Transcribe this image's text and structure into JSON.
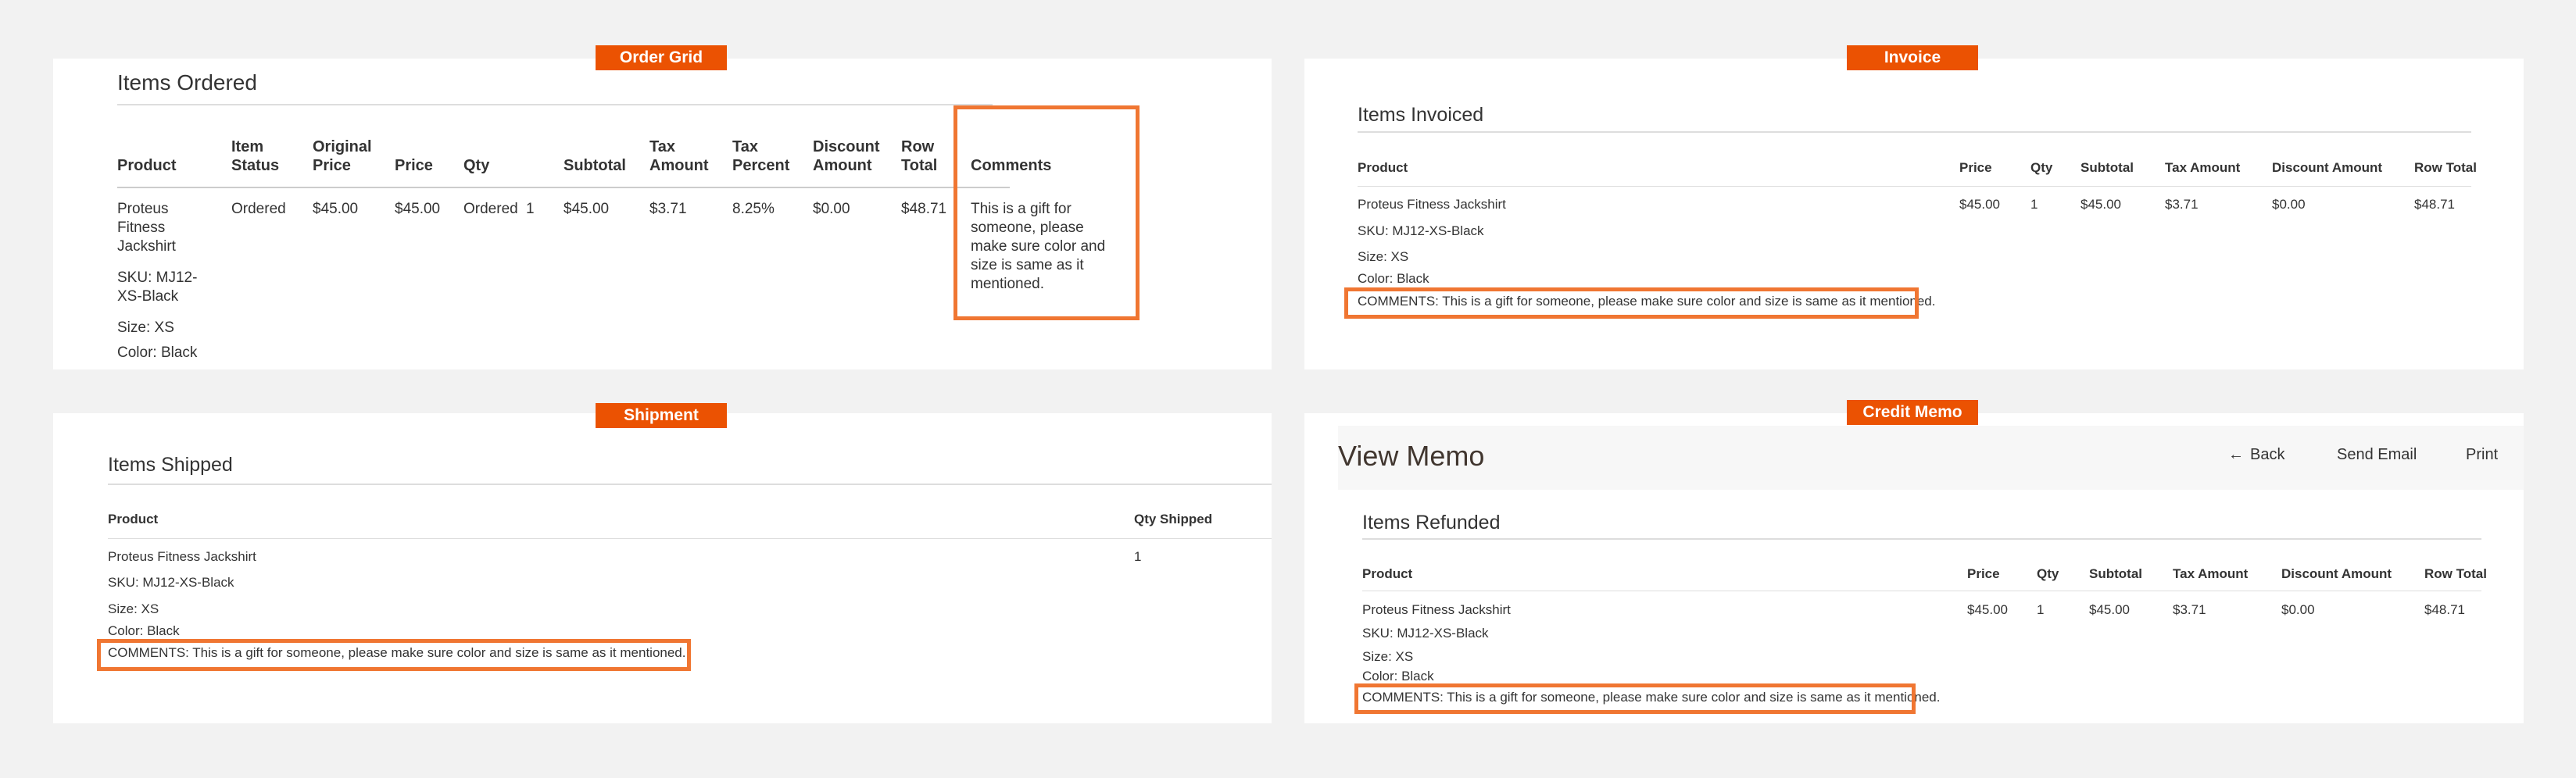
{
  "badges": {
    "order_grid": "Order Grid",
    "invoice": "Invoice",
    "shipment": "Shipment",
    "credit_memo": "Credit Memo"
  },
  "order_grid": {
    "title": "Items Ordered",
    "headers": {
      "product": "Product",
      "item_status_1": "Item",
      "item_status_2": "Status",
      "original_price_1": "Original",
      "original_price_2": "Price",
      "price": "Price",
      "qty": "Qty",
      "subtotal": "Subtotal",
      "tax_amount_1": "Tax",
      "tax_amount_2": "Amount",
      "tax_percent_1": "Tax",
      "tax_percent_2": "Percent",
      "discount_amount_1": "Discount",
      "discount_amount_2": "Amount",
      "row_total_1": "Row",
      "row_total_2": "Total",
      "comments": "Comments"
    },
    "row": {
      "product_line1": "Proteus",
      "product_line2": "Fitness",
      "product_line3": "Jackshirt",
      "sku_line1": "SKU: MJ12-",
      "sku_line2": "XS-Black",
      "size": "Size: XS",
      "color": "Color: Black",
      "status": "Ordered",
      "original_price": "$45.00",
      "price": "$45.00",
      "qty_label": "Ordered",
      "qty_value": "1",
      "subtotal": "$45.00",
      "tax_amount": "$3.71",
      "tax_percent": "8.25%",
      "discount_amount": "$0.00",
      "row_total": "$48.71",
      "comment_lines": [
        "This is a gift for",
        "someone, please",
        "make sure color and",
        "size is same as it",
        "mentioned."
      ]
    }
  },
  "invoice": {
    "title": "Items Invoiced",
    "headers": {
      "product": "Product",
      "price": "Price",
      "qty": "Qty",
      "subtotal": "Subtotal",
      "tax_amount": "Tax Amount",
      "discount_amount": "Discount Amount",
      "row_total": "Row Total"
    },
    "row": {
      "product": "Proteus Fitness Jackshirt",
      "sku": "SKU: MJ12-XS-Black",
      "size": "Size: XS",
      "color": "Color: Black",
      "comments": "COMMENTS: This is a gift for someone, please make sure color and size is same as it mentioned.",
      "price": "$45.00",
      "qty": "1",
      "subtotal": "$45.00",
      "tax_amount": "$3.71",
      "discount_amount": "$0.00",
      "row_total": "$48.71"
    }
  },
  "shipment": {
    "title": "Items Shipped",
    "headers": {
      "product": "Product",
      "qty_shipped": "Qty Shipped"
    },
    "row": {
      "product": "Proteus Fitness Jackshirt",
      "sku": "SKU: MJ12-XS-Black",
      "size": "Size: XS",
      "color": "Color: Black",
      "comments": "COMMENTS: This is a gift for someone, please make sure color and size is same as it mentioned.",
      "qty_shipped": "1"
    }
  },
  "credit_memo": {
    "page_title": "View Memo",
    "actions": {
      "back": "Back",
      "send_email": "Send Email",
      "print": "Print"
    },
    "title": "Items Refunded",
    "headers": {
      "product": "Product",
      "price": "Price",
      "qty": "Qty",
      "subtotal": "Subtotal",
      "tax_amount": "Tax Amount",
      "discount_amount": "Discount Amount",
      "row_total": "Row Total"
    },
    "row": {
      "product": "Proteus Fitness Jackshirt",
      "sku": "SKU: MJ12-XS-Black",
      "size": "Size: XS",
      "color": "Color: Black",
      "comments": "COMMENTS: This is a gift for someone, please make sure color and size is same as it mentioned.",
      "price": "$45.00",
      "qty": "1",
      "subtotal": "$45.00",
      "tax_amount": "$3.71",
      "discount_amount": "$0.00",
      "row_total": "$48.71"
    }
  },
  "colors": {
    "badge": "#eb5202",
    "highlight": "#f07632",
    "background": "#f2f2f2"
  }
}
